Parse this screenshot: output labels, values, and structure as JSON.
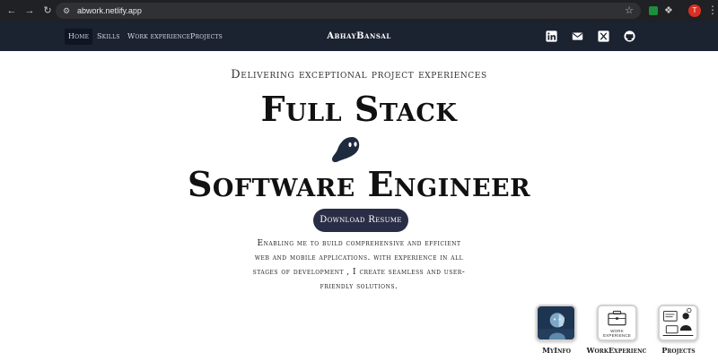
{
  "browser": {
    "url": "abwork.netlify.app",
    "profile_initial": "T"
  },
  "navbar": {
    "links": [
      "Home",
      "Skills",
      "Work experience",
      "Projects"
    ],
    "brand": "AbhayBansal",
    "social_icons": [
      "linkedin-icon",
      "mail-icon",
      "x-icon",
      "github-icon"
    ]
  },
  "hero": {
    "tagline": "Delivering exceptional project experiences",
    "title_line1": "Full Stack",
    "title_line2": "Software Engineer",
    "resume_button": "Download Resume",
    "description": "Enabling me to build comprehensive and efficient web and mobile applications. with experience in all stages of development , I create seamless and user-friendly solutions."
  },
  "dock": {
    "items": [
      {
        "label": "MyInfo",
        "icon": "profile-ai-icon"
      },
      {
        "label": "WorkExperienc",
        "icon": "briefcase-icon",
        "caption": "WORK EXPERIENCE"
      },
      {
        "label": "Projects",
        "icon": "projects-illustration-icon"
      }
    ]
  },
  "colors": {
    "navbar_bg": "#1b2230",
    "button_bg": "#2a2d46",
    "chrome_bg": "#202124"
  }
}
